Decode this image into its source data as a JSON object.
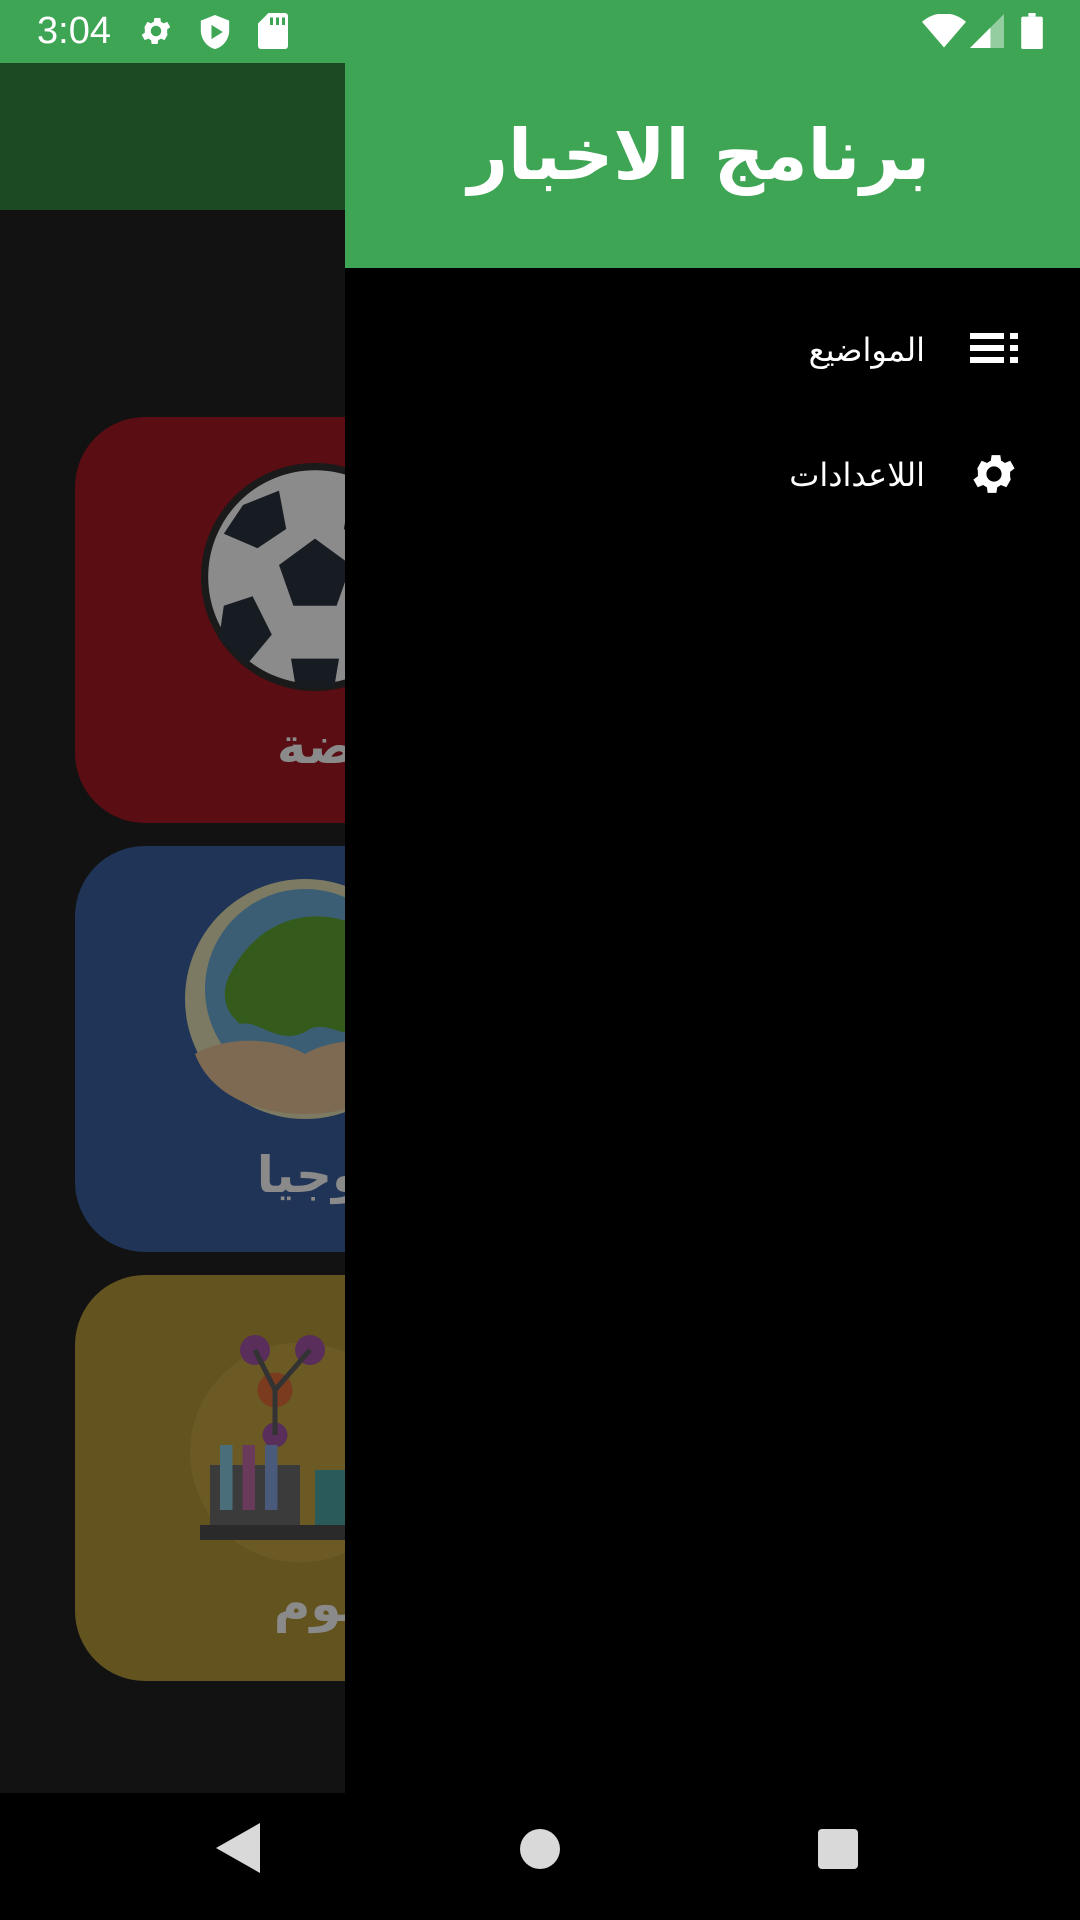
{
  "status_bar": {
    "time": "3:04",
    "icons": [
      "settings-icon",
      "play-protect-icon",
      "sd-card-icon",
      "wifi-icon",
      "cellular-signal-icon",
      "battery-icon"
    ]
  },
  "drawer": {
    "title": "برنامج الاخبار",
    "items": [
      {
        "label": "المواضيع",
        "icon": "list-icon"
      },
      {
        "label": "اللاعدادات",
        "icon": "gear-icon"
      }
    ]
  },
  "background_app": {
    "cards": [
      {
        "label": "الرياضة",
        "visible_label": "ياضة",
        "color": "#5a0d12",
        "icon": "soccer-ball-icon"
      },
      {
        "label": "التكنولوجيا",
        "visible_label": "ولوجيا",
        "color": "#1f3456",
        "icon": "earth-in-hands-icon"
      },
      {
        "label": "العلوم",
        "visible_label": "علوم",
        "color": "#62531f",
        "icon": "science-lab-icon"
      }
    ]
  },
  "nav_bar": {
    "buttons": [
      "back-icon",
      "home-icon",
      "recents-icon"
    ]
  },
  "colors": {
    "accent": "#3da553",
    "drawer_background": "#000000"
  }
}
